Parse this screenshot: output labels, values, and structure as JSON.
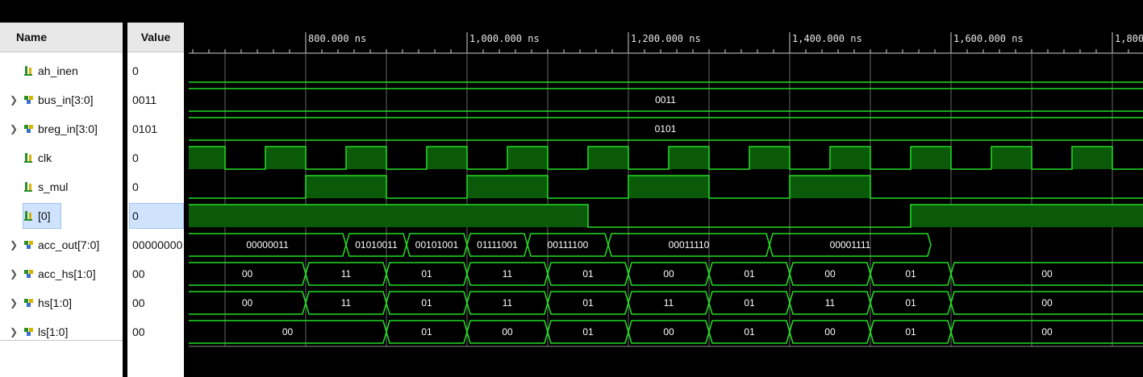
{
  "headers": {
    "name": "Name",
    "value": "Value"
  },
  "timeline": {
    "ticks": [
      "800.000 ns",
      "1,000.000 ns",
      "1,200.000 ns",
      "1,400.000 ns",
      "1,600.000 ns",
      "1,800"
    ]
  },
  "signals": [
    {
      "name": "ah_inen",
      "value": "0",
      "expandable": false,
      "icon": "bit-signal-icon"
    },
    {
      "name": "bus_in[3:0]",
      "value": "0011",
      "expandable": true,
      "icon": "bus-signal-icon"
    },
    {
      "name": "breg_in[3:0]",
      "value": "0101",
      "expandable": true,
      "icon": "bus-signal-icon"
    },
    {
      "name": "clk",
      "value": "0",
      "expandable": false,
      "icon": "bit-signal-icon"
    },
    {
      "name": "s_mul",
      "value": "0",
      "expandable": false,
      "icon": "bit-signal-icon"
    },
    {
      "name": "[0]",
      "value": "0",
      "expandable": false,
      "icon": "bit-signal-icon",
      "selected": true
    },
    {
      "name": "acc_out[7:0]",
      "value": "00000000",
      "expandable": true,
      "icon": "bus-signal-icon"
    },
    {
      "name": "acc_hs[1:0]",
      "value": "00",
      "expandable": true,
      "icon": "bus-signal-icon"
    },
    {
      "name": "hs[1:0]",
      "value": "00",
      "expandable": true,
      "icon": "bus-signal-icon"
    },
    {
      "name": "ls[1:0]",
      "value": "00",
      "expandable": true,
      "icon": "bus-signal-icon"
    }
  ],
  "waves": {
    "bus_in": [
      "0011"
    ],
    "breg_in": [
      "0101"
    ],
    "acc_out": [
      "00000011",
      "01010011",
      "00101001",
      "01111001",
      "00111100",
      "00011110",
      "00001111"
    ],
    "acc_hs": [
      "00",
      "11",
      "01",
      "11",
      "01",
      "00",
      "01",
      "00",
      "01",
      "00"
    ],
    "hs": [
      "00",
      "11",
      "01",
      "11",
      "01",
      "11",
      "01",
      "11",
      "01",
      "00"
    ],
    "ls": [
      "00",
      "01",
      "00",
      "01",
      "00",
      "01",
      "00",
      "01",
      "00"
    ]
  },
  "colors": {
    "wave_line": "#22dd22",
    "wave_fill": "#0a5a0a",
    "grid": "#666666",
    "selected": "#cfe3ff"
  }
}
